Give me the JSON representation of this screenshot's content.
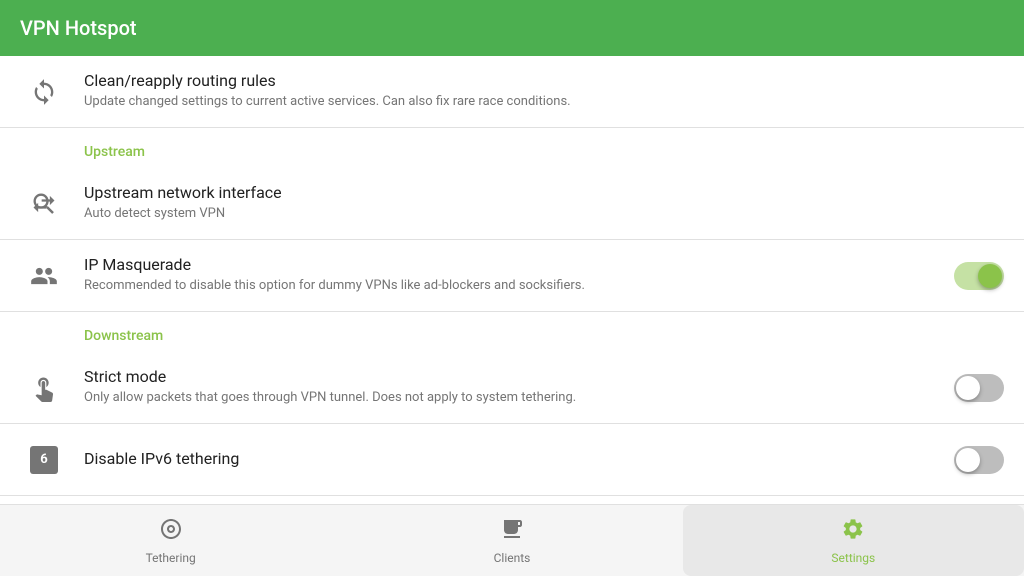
{
  "header": {
    "title": "VPN Hotspot"
  },
  "items": {
    "clean_reapply": {
      "title": "Clean/reapply routing rules",
      "subtitle": "Update changed settings to current active services. Can also fix rare race conditions."
    },
    "upstream_section": "Upstream",
    "upstream_network": {
      "title": "Upstream network interface",
      "subtitle": "Auto detect system VPN"
    },
    "ip_masquerade": {
      "title": "IP Masquerade",
      "subtitle": "Recommended to disable this option for dummy VPNs like ad-blockers and socksifiers.",
      "enabled": true
    },
    "downstream_section": "Downstream",
    "strict_mode": {
      "title": "Strict mode",
      "subtitle": "Only allow packets that goes through VPN tunnel. Does not apply to system tethering.",
      "enabled": false
    },
    "disable_ipv6": {
      "title": "Disable IPv6 tethering",
      "subtitle": "",
      "enabled": false
    }
  },
  "bottom_nav": {
    "tethering": "Tethering",
    "clients": "Clients",
    "settings": "Settings"
  }
}
